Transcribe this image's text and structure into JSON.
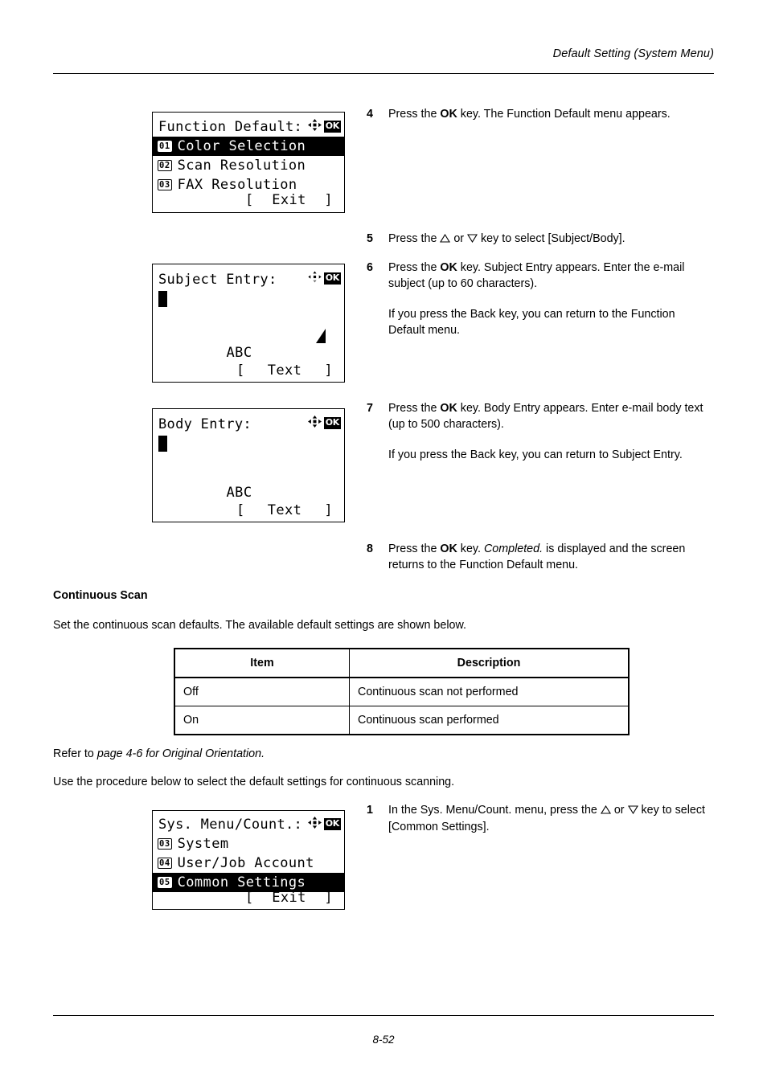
{
  "header": {
    "title": "Default Setting (System Menu)"
  },
  "footer": {
    "page_number": "8-52"
  },
  "panels": {
    "function_default": {
      "title": "Function Default:",
      "nav_icon": "four-way-arrow-icon",
      "ok_badge": "OK",
      "items": [
        {
          "num": "01",
          "label": "Color Selection",
          "selected": true
        },
        {
          "num": "02",
          "label": "Scan Resolution",
          "selected": false
        },
        {
          "num": "03",
          "label": "FAX Resolution",
          "selected": false
        }
      ],
      "bracket_left": "[",
      "bracket_label": "Exit",
      "bracket_right": "]"
    },
    "subject_entry": {
      "title": "Subject Entry:",
      "nav_icon": "four-way-arrow-icon",
      "ok_badge": "OK",
      "input_value": "",
      "mode_label": "ABC",
      "has_enter_arrow": true,
      "bracket_left": "[",
      "bracket_label": "Text",
      "bracket_right": "]"
    },
    "body_entry": {
      "title": "Body Entry:",
      "nav_icon": "four-way-arrow-icon",
      "ok_badge": "OK",
      "input_value": "",
      "mode_label": "ABC",
      "has_enter_arrow": false,
      "bracket_left": "[",
      "bracket_label": "Text",
      "bracket_right": "]"
    },
    "sys_menu_count": {
      "title": "Sys. Menu/Count.:",
      "nav_icon": "four-way-arrow-icon",
      "ok_badge": "OK",
      "items": [
        {
          "num": "03",
          "label": "System",
          "selected": false
        },
        {
          "num": "04",
          "label": "User/Job Account",
          "selected": false
        },
        {
          "num": "05",
          "label": "Common Settings",
          "selected": true
        }
      ],
      "bracket_left": "[",
      "bracket_label": "Exit",
      "bracket_right": "]"
    }
  },
  "steps": {
    "s4": {
      "num": "4",
      "p1_a": "Press the ",
      "p1_b": "OK",
      "p1_c": " key. The Function Default menu appears."
    },
    "s5": {
      "num": "5",
      "p1_a": "Press the ",
      "p1_b": " or ",
      "p1_c": " key to select [Subject/Body]."
    },
    "s6": {
      "num": "6",
      "p1_a": "Press the ",
      "p1_b": "OK",
      "p1_c": " key. Subject Entry appears. Enter the e-mail subject (up to 60 characters).",
      "p2": "If you press the Back key, you can return to the Function Default menu."
    },
    "s7": {
      "num": "7",
      "p1_a": "Press the ",
      "p1_b": "OK",
      "p1_c": " key. Body Entry appears. Enter e-mail body text (up to 500 characters).",
      "p2": "If you press the Back key, you can return to Subject Entry."
    },
    "s8": {
      "num": "8",
      "p1_a": "Press the ",
      "p1_b": "OK",
      "p1_c": " key. ",
      "p1_d": "Completed.",
      "p1_e": " is displayed and the screen returns to the Function Default menu."
    },
    "s1": {
      "num": "1",
      "p1_a": "In the Sys. Menu/Count. menu, press the ",
      "p1_b": " or ",
      "p1_c": " key to select [Common Settings]."
    }
  },
  "section": {
    "heading": "Continuous Scan",
    "intro": "Set the continuous scan defaults. The available default settings are shown below.",
    "refer_a": "Refer to ",
    "refer_b": "page 4-6 for Original Orientation.",
    "procedure": "Use the procedure below to select the default settings for continuous scanning."
  },
  "table": {
    "columns": [
      "Item",
      "Description"
    ],
    "rows": [
      [
        "Off",
        "Continuous scan not performed"
      ],
      [
        "On",
        "Continuous scan performed"
      ]
    ]
  }
}
